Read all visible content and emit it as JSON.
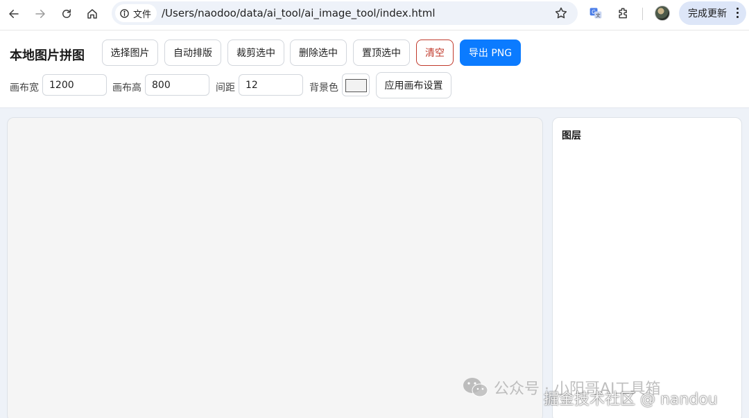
{
  "browser": {
    "site_chip_label": "文件",
    "url": "/Users/naodoo/data/ai_tool/ai_image_tool/index.html",
    "update_label": "完成更新",
    "icons": [
      "back-arrow-icon",
      "forward-arrow-icon",
      "reload-icon",
      "home-icon",
      "info-icon",
      "bookmark-star-icon",
      "translate-icon",
      "extensions-icon",
      "more-vertical-icon"
    ]
  },
  "app": {
    "title": "本地图片拼图",
    "buttons": {
      "select": "选择图片",
      "auto_layout": "自动排版",
      "crop": "裁剪选中",
      "delete": "删除选中",
      "bring_top": "置顶选中",
      "clear": "清空",
      "export": "导出 PNG",
      "apply": "应用画布设置"
    },
    "settings": {
      "width_label": "画布宽",
      "width_value": "1200",
      "height_label": "画布高",
      "height_value": "800",
      "gap_label": "间距",
      "gap_value": "12",
      "bg_label": "背景色",
      "bg_color": "#f2f2f2"
    },
    "layers_title": "图层"
  },
  "colors": {
    "accent": "#0b7bff",
    "danger": "#c0392b",
    "workarea_bg": "#eef2f8"
  },
  "watermark": {
    "line1": "公众号 · 小阳哥AI工具箱",
    "line2": "掘金技术社区 @ nandou"
  }
}
